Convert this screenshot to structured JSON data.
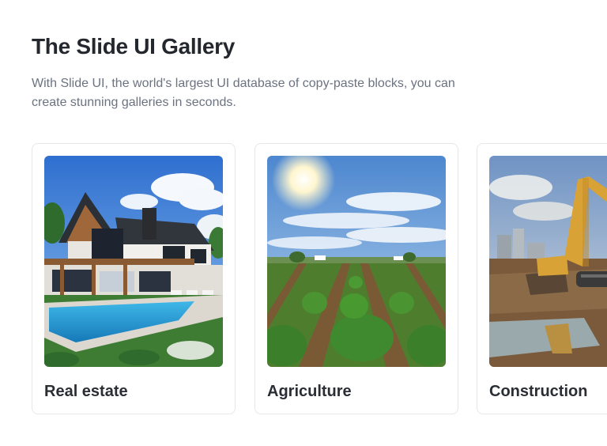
{
  "header": {
    "title": "The Slide UI Gallery",
    "subtitle": "With Slide UI, the world's largest UI database of copy-paste blocks, you can create stunning galleries in seconds."
  },
  "gallery": {
    "cards": [
      {
        "label": "Real estate",
        "image": "modern-house-with-pool-photo"
      },
      {
        "label": "Agriculture",
        "image": "crop-field-rows-photo"
      },
      {
        "label": "Construction",
        "image": "excavator-construction-site-photo"
      }
    ]
  },
  "colors": {
    "title": "#24282e",
    "subtitle": "#6b7280",
    "card_border": "#e5e7eb",
    "background": "#ffffff"
  }
}
